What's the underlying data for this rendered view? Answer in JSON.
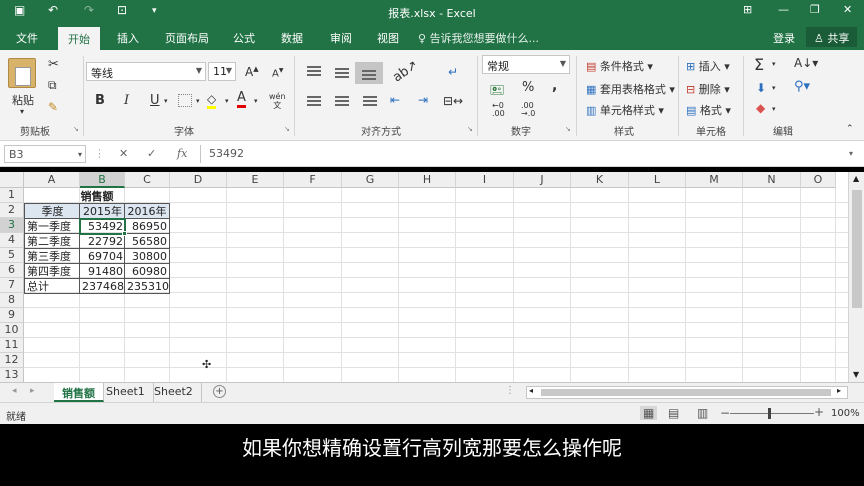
{
  "window": {
    "title": "报表.xlsx - Excel",
    "accent": "#217346"
  },
  "quick_access": [
    "save-icon",
    "undo-icon",
    "redo-icon",
    "form-icon",
    "customize-icon"
  ],
  "tabs": [
    {
      "label": "文件"
    },
    {
      "label": "开始"
    },
    {
      "label": "插入"
    },
    {
      "label": "页面布局"
    },
    {
      "label": "公式"
    },
    {
      "label": "数据"
    },
    {
      "label": "审阅"
    },
    {
      "label": "视图"
    }
  ],
  "active_tab": "开始",
  "tell_me": "告诉我您想要做什么...",
  "login": "登录",
  "share": "共享",
  "ribbon": {
    "clipboard": {
      "paste": "粘贴",
      "label": "剪贴板"
    },
    "font": {
      "name": "等线",
      "size": "11",
      "label": "字体",
      "bold": "B",
      "italic": "I",
      "underline": "U",
      "font_color": "A",
      "wen": "wén\n文"
    },
    "alignment": {
      "label": "对齐方式"
    },
    "number": {
      "format": "常规",
      "label": "数字",
      "percent": "%",
      "comma": ","
    },
    "styles": {
      "conditional": "条件格式",
      "table": "套用表格格式",
      "cell_styles": "单元格样式",
      "label": "样式"
    },
    "cells": {
      "insert": "插入",
      "delete": "删除",
      "format": "格式",
      "label": "单元格"
    },
    "editing": {
      "label": "编辑"
    }
  },
  "formula_bar": {
    "name_box": "B3",
    "fx": "fx",
    "value": "53492"
  },
  "columns": [
    "A",
    "B",
    "C",
    "D",
    "E",
    "F",
    "G",
    "H",
    "I",
    "J",
    "K",
    "L",
    "M",
    "N",
    "O"
  ],
  "rows": [
    "1",
    "2",
    "3",
    "4",
    "5",
    "6",
    "7",
    "8",
    "9",
    "10",
    "11",
    "12",
    "13"
  ],
  "selected_cell": "B3",
  "sheet": {
    "title": "销售额",
    "headers": [
      "季度",
      "2015年",
      "2016年"
    ],
    "data": [
      [
        "第一季度",
        "53492",
        "86950"
      ],
      [
        "第二季度",
        "22792",
        "56580"
      ],
      [
        "第三季度",
        "69704",
        "30800"
      ],
      [
        "第四季度",
        "91480",
        "60980"
      ],
      [
        "总计",
        "237468",
        "235310"
      ]
    ]
  },
  "sheet_tabs": [
    {
      "label": "销售额",
      "active": true
    },
    {
      "label": "Sheet1",
      "active": false
    },
    {
      "label": "Sheet2",
      "active": false
    }
  ],
  "status": {
    "ready": "就绪",
    "zoom": "100%"
  },
  "subtitle": "如果你想精确设置行高列宽那要怎么操作呢"
}
